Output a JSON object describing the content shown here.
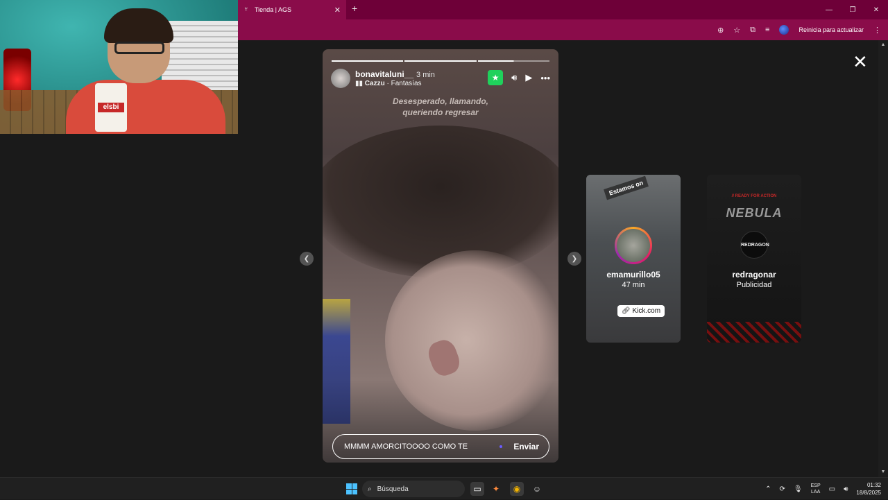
{
  "browser": {
    "tab_title": "Tienda | AGS",
    "tab_close": "✕",
    "new_tab": "+",
    "restart_label": "Reinicia para actualizar",
    "window_min": "—",
    "window_max": "❐",
    "window_close": "✕"
  },
  "webcam": {
    "mug_label": "elsbi"
  },
  "story": {
    "username": "bonavitaluni__",
    "time": "3 min",
    "music_artist": "Cazzu",
    "music_song": "· Fantasías",
    "lyric_line1": "Desesperado, llamando,",
    "lyric_line2": "queriendo regresar",
    "reply_text": "MMMM AMORCITOOOO COMO TE",
    "send_label": "Enviar",
    "progress": [
      1,
      1,
      0.5
    ]
  },
  "next_stories": [
    {
      "username": "emamurillo05",
      "time": "47 min",
      "tag": "Estamos on",
      "link": "Kick.com"
    },
    {
      "username": "redragonar",
      "subtitle": "Publicidad",
      "banner": "NEBULA",
      "small_text": "// READY FOR ACTION",
      "avatar_text": "REDRAGON"
    }
  ],
  "taskbar": {
    "search_placeholder": "Búsqueda",
    "lang_line1": "ESP",
    "lang_line2": "LAA",
    "time": "01:32",
    "date": "18/8/2025"
  },
  "colors": {
    "browser_frame": "#6e0038",
    "toolbar": "#8a0c4a",
    "close_friends_green": "#1fd15c",
    "stage_bg": "#1a1a1a"
  }
}
